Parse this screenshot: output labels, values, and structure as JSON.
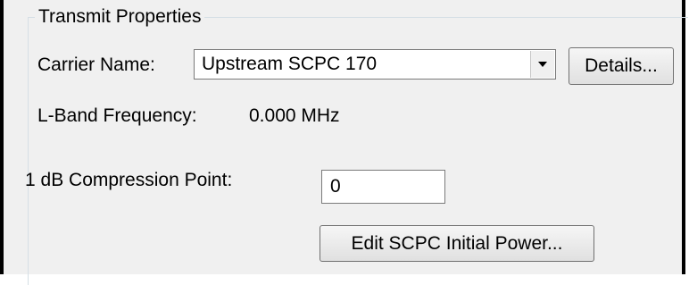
{
  "group": {
    "title": "Transmit Properties"
  },
  "carrier": {
    "label": "Carrier Name:",
    "selected_value": "Upstream SCPC 170",
    "details_button": "Details..."
  },
  "frequency": {
    "label": "L-Band Frequency:",
    "value": "0.000 MHz"
  },
  "compression": {
    "label": "1 dB Compression Point:",
    "value": "0"
  },
  "edit_button": {
    "label": "Edit SCPC Initial Power..."
  },
  "icons": {
    "dropdown": "chevron-down-icon"
  },
  "colors": {
    "panel_background": "#f0f0f0",
    "frame_line": "#d5dfe5",
    "field_border": "#7a7a7a"
  }
}
